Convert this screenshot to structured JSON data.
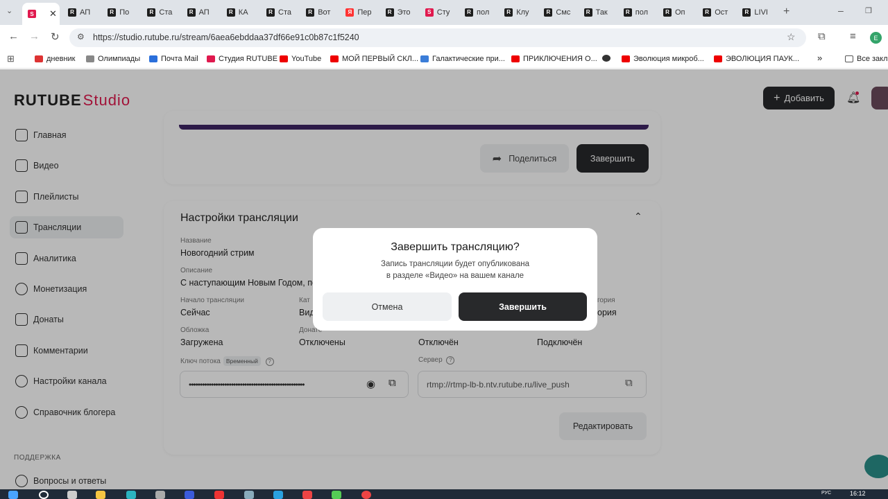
{
  "browser": {
    "tabs": [
      {
        "label": "",
        "icon": "rutube-studio-icon",
        "color": "#e0194e"
      },
      {
        "label": "АП",
        "icon": "rutube-icon",
        "color": "#1e1e1e"
      },
      {
        "label": "По",
        "icon": "rutube-icon",
        "color": "#1e1e1e"
      },
      {
        "label": "Ста",
        "icon": "rutube-icon",
        "color": "#1e1e1e"
      },
      {
        "label": "АП",
        "icon": "rutube-icon",
        "color": "#1e1e1e"
      },
      {
        "label": "КА",
        "icon": "rutube-icon",
        "color": "#1e1e1e"
      },
      {
        "label": "Ста",
        "icon": "rutube-icon",
        "color": "#1e1e1e"
      },
      {
        "label": "Вот",
        "icon": "rutube-icon",
        "color": "#1e1e1e"
      },
      {
        "label": "Пер",
        "icon": "yandex-icon",
        "color": "#f33"
      },
      {
        "label": "Это",
        "icon": "rutube-icon",
        "color": "#1e1e1e"
      },
      {
        "label": "Сту",
        "icon": "rutube-studio-icon",
        "color": "#e0194e"
      },
      {
        "label": "пол",
        "icon": "rutube-icon",
        "color": "#1e1e1e"
      },
      {
        "label": "Клу",
        "icon": "rutube-icon",
        "color": "#1e1e1e"
      },
      {
        "label": "Смс",
        "icon": "rutube-icon",
        "color": "#1e1e1e"
      },
      {
        "label": "Так",
        "icon": "rutube-icon",
        "color": "#1e1e1e"
      },
      {
        "label": "пол",
        "icon": "rutube-icon",
        "color": "#1e1e1e"
      },
      {
        "label": "Оп",
        "icon": "rutube-icon",
        "color": "#1e1e1e"
      },
      {
        "label": "Ост",
        "icon": "rutube-icon",
        "color": "#1e1e1e"
      },
      {
        "label": "LIVI",
        "icon": "rutube-icon",
        "color": "#1e1e1e"
      }
    ],
    "url": "https://studio.rutube.ru/stream/6aea6ebddaa37df66e91c0b87c1f5240",
    "profile_initial": "E",
    "bookmarks": [
      {
        "label": "дневник",
        "color": "#d33"
      },
      {
        "label": "Олимпиады",
        "color": "#888"
      },
      {
        "label": "Почта Mail",
        "color": "#2a6fdb"
      },
      {
        "label": "Студия RUTUBE",
        "color": "#e0194e"
      },
      {
        "label": "YouTube",
        "color": "#e00"
      },
      {
        "label": "МОЙ ПЕРВЫЙ СКЛ...",
        "color": "#e00"
      },
      {
        "label": "Галактические при...",
        "color": "#3b7dd8"
      },
      {
        "label": "ПРИКЛЮЧЕНИЯ О...",
        "color": "#e00"
      },
      {
        "label": "",
        "color": "#333"
      },
      {
        "label": "Эволюция микроб...",
        "color": "#e00"
      },
      {
        "label": "ЭВОЛЮЦИЯ ПАУК...",
        "color": "#e00"
      }
    ],
    "bookmarks_more": "»",
    "all_bookmarks": "Все закл"
  },
  "app": {
    "logo_main": "RUTUBE",
    "logo_studio": "Studio",
    "add_button": "Добавить",
    "nav": [
      {
        "label": "Главная",
        "icon": "home-icon"
      },
      {
        "label": "Видео",
        "icon": "video-icon"
      },
      {
        "label": "Плейлисты",
        "icon": "playlist-icon"
      },
      {
        "label": "Трансляции",
        "icon": "broadcast-icon"
      },
      {
        "label": "Аналитика",
        "icon": "analytics-icon"
      },
      {
        "label": "Монетизация",
        "icon": "ruble-icon"
      },
      {
        "label": "Донаты",
        "icon": "donate-icon"
      },
      {
        "label": "Комментарии",
        "icon": "comment-icon"
      },
      {
        "label": "Настройки канала",
        "icon": "settings-icon"
      },
      {
        "label": "Справочник блогера",
        "icon": "info-icon"
      }
    ],
    "nav_section": "ПОДДЕРЖКА",
    "nav_support": "Вопросы и ответы",
    "share_button": "Поделиться",
    "end_button": "Завершить",
    "settings": {
      "title": "Настройки трансляции",
      "name_label": "Название",
      "name_value": "Новогодний стрим",
      "desc_label": "Описание",
      "desc_value": "С наступающим Новым Годом, пол",
      "start_label": "Начало трансляции",
      "start_value": "Сейчас",
      "cat_label": "Кат",
      "cat_value": "Вид",
      "cat2_label": "гория",
      "cat2_value": "ория",
      "cover_label": "Обложка",
      "cover_value": "Загружена",
      "donate_label": "Донате",
      "donate_value": "Отключены",
      "col3_value": "Отключён",
      "col4_value": "Подключён",
      "key_label": "Ключ потока",
      "key_badge": "Временный",
      "key_value": "••••••••••••••••••••••••••••••••••••••••••••••••••••",
      "server_label": "Сервер",
      "server_value": "rtmp://rtmp-lb-b.ntv.rutube.ru/live_push",
      "edit_button": "Редактировать"
    }
  },
  "modal": {
    "title": "Завершить трансляцию?",
    "text_line1": "Запись трансляции будет опубликована",
    "text_line2": "в разделе «Видео» на вашем канале",
    "cancel": "Отмена",
    "confirm": "Завершить"
  },
  "taskbar": {
    "time": "16:12",
    "lang": "РУС"
  }
}
